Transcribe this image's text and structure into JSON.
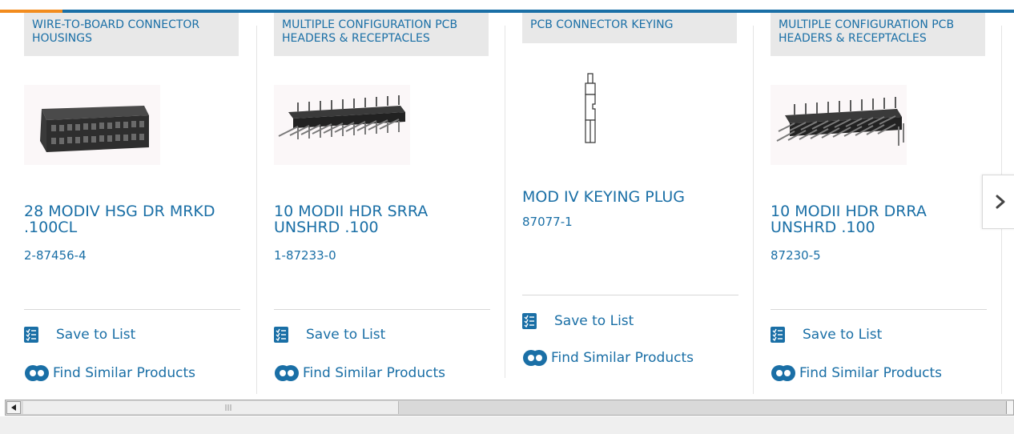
{
  "products": [
    {
      "category": "WIRE-TO-BOARD CONNECTOR HOUSINGS",
      "name": "28 MODIV HSG DR MRKD .100CL",
      "part_number": "2-87456-4",
      "image": "connector-housing-image"
    },
    {
      "category": "MULTIPLE CONFIGURATION PCB HEADERS & RECEPTACLES",
      "name": "10 MODII HDR SRRA UNSHRD .100",
      "part_number": "1-87233-0",
      "image": "single-row-header-image"
    },
    {
      "category": "PCB CONNECTOR KEYING",
      "name": "MOD IV KEYING PLUG",
      "part_number": "87077-1",
      "image": "keying-plug-image"
    },
    {
      "category": "MULTIPLE CONFIGURATION PCB HEADERS & RECEPTACLES",
      "name": "10 MODII HDR DRRA UNSHRD .100",
      "part_number": "87230-5",
      "image": "double-row-header-image"
    }
  ],
  "actions": {
    "save_label": "Save to List",
    "similar_label": "Find Similar Products"
  },
  "navigation": {
    "next_icon": "chevron-right-icon"
  },
  "colors": {
    "link": "#1a6fa6",
    "accent": "#f28c1e",
    "category_bg": "#e8e8e8"
  }
}
